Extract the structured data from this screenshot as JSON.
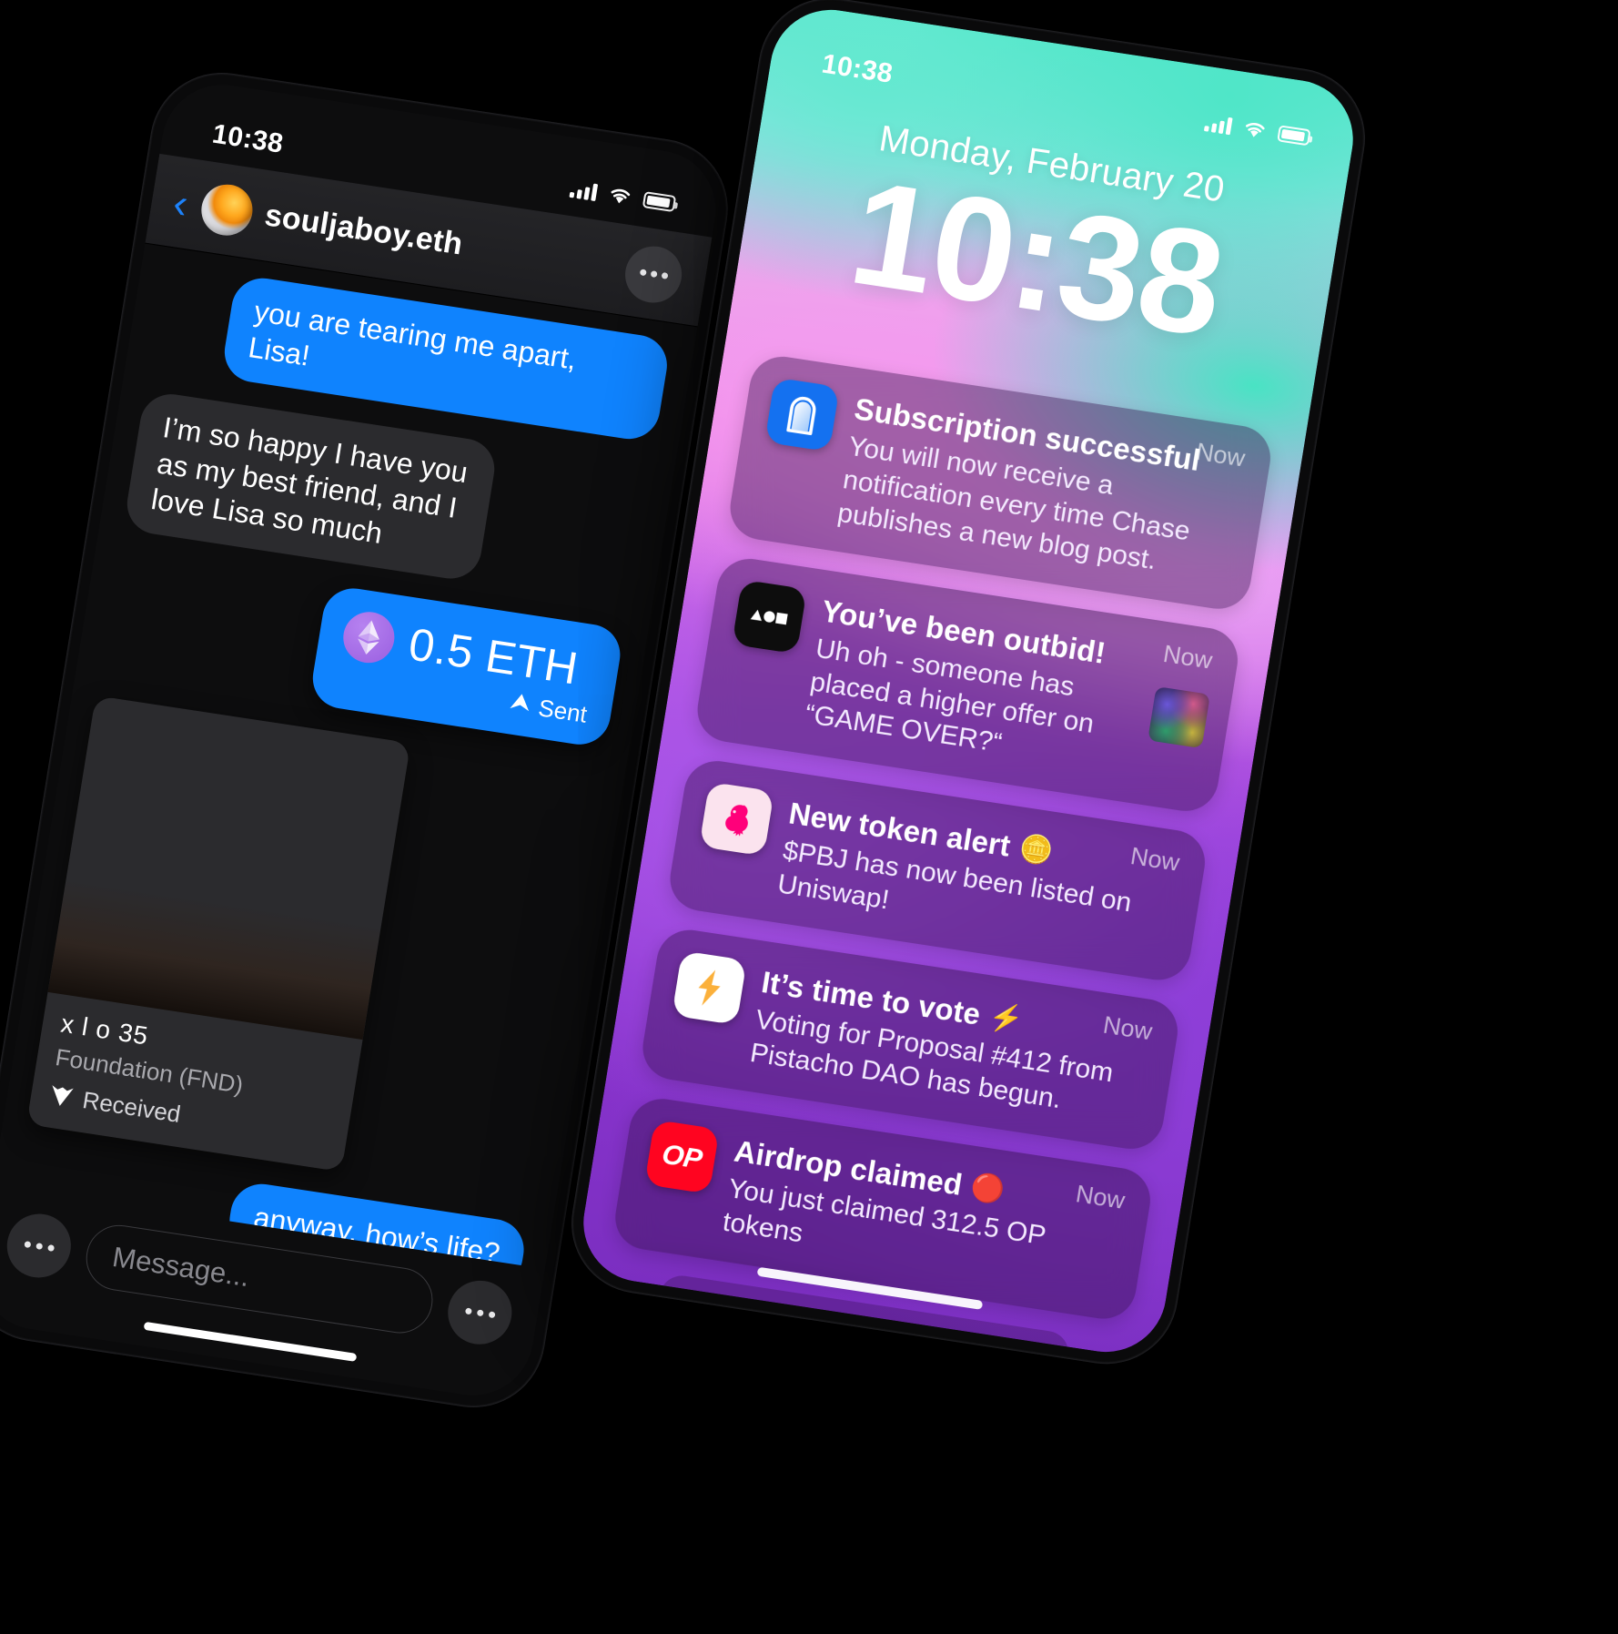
{
  "left_phone": {
    "status": {
      "time": "10:38",
      "signal_icon": "cellular-bars-icon",
      "wifi_icon": "wifi-icon",
      "battery_icon": "battery-icon"
    },
    "header": {
      "back_icon": "back-chevron-icon",
      "avatar_icon": "contact-avatar",
      "title": "souljaboy.eth",
      "more_icon": "more-dots-icon"
    },
    "messages": [
      {
        "side": "out",
        "type": "text",
        "text": "you are tearing me apart, Lisa!"
      },
      {
        "side": "in",
        "type": "text",
        "text": "I’m so happy I have you as my best friend, and I love Lisa so much"
      }
    ],
    "payment": {
      "coin_icon": "ethereum-icon",
      "amount": "0.5 ETH",
      "status_icon": "sent-arrow-icon",
      "status": "Sent"
    },
    "nft": {
      "image_alt": "nft-artwork",
      "title": "x l o 35",
      "marketplace": "Foundation (FND)",
      "status_icon": "foundation-v-icon",
      "status": "Received"
    },
    "last_message": {
      "side": "out",
      "type": "text",
      "text": "anyway, how’s life?"
    },
    "composer": {
      "left_more_icon": "more-dots-icon",
      "input_placeholder": "Message...",
      "input_value": "",
      "right_more_icon": "more-dots-icon"
    },
    "home_indicator": "home-indicator"
  },
  "right_phone": {
    "status": {
      "time": "10:38",
      "signal_icon": "cellular-bars-icon",
      "wifi_icon": "wifi-icon",
      "battery_icon": "battery-icon"
    },
    "lock": {
      "date": "Monday, February 20",
      "time": "10:38"
    },
    "notifications": [
      {
        "app_icon": "mirror-app-icon",
        "title": "Subscription successful",
        "title_emoji": "",
        "body": "You will now receive a notification every time Chase publishes a new blog post.",
        "when": "Now",
        "thumb": null
      },
      {
        "app_icon": "foundation-app-icon",
        "title": "You’ve been outbid!",
        "title_emoji": "",
        "body": "Uh oh - someone has placed a higher offer on “GAME OVER?“",
        "when": "Now",
        "thumb": "nft-thumbnail"
      },
      {
        "app_icon": "uniswap-app-icon",
        "title": "New token alert",
        "title_emoji": "🪙",
        "body": "$PBJ has now been listed on Uniswap!",
        "when": "Now",
        "thumb": null
      },
      {
        "app_icon": "snapshot-app-icon",
        "title": "It’s time to vote",
        "title_emoji": "⚡",
        "body": "Voting for Proposal #412 from Pistacho DAO has begun.",
        "when": "Now",
        "thumb": null
      },
      {
        "app_icon": "optimism-app-icon",
        "app_icon_label": "OP",
        "title": "Airdrop claimed",
        "title_emoji": "🔴",
        "body": "You just claimed 312.5 OP tokens",
        "when": "Now",
        "thumb": null
      }
    ],
    "home_indicator": "home-indicator"
  },
  "colors": {
    "imessage_blue": "#0f83fe",
    "bubble_gray": "#2b2b2e",
    "optimism_red": "#ff0420",
    "mirror_blue": "#1471f0",
    "uniswap_pink": "#ff007a",
    "screen_black": "#0d0d0e"
  }
}
